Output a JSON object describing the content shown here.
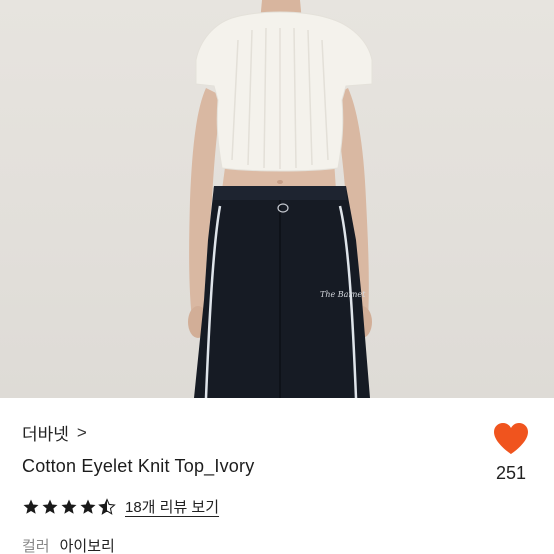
{
  "product": {
    "brand": "더바넷",
    "brand_chevron": ">",
    "title": "Cotton Eyelet Knit Top_Ivory",
    "rating": 4.5,
    "review_link": "18개 리뷰 보기",
    "option_label": "컬러",
    "option_value": "아이보리",
    "like_count": "251",
    "pants_logo_text": "The Barnet"
  },
  "colors": {
    "heart": "#f0541e",
    "star": "#1a1a1a",
    "pants": "#161b24",
    "piping": "#dfe4ea",
    "top": "#f4f2ec"
  },
  "icons": {
    "like": "heart-icon",
    "rating": "star-icon",
    "brand_link": "chevron-right-icon"
  }
}
